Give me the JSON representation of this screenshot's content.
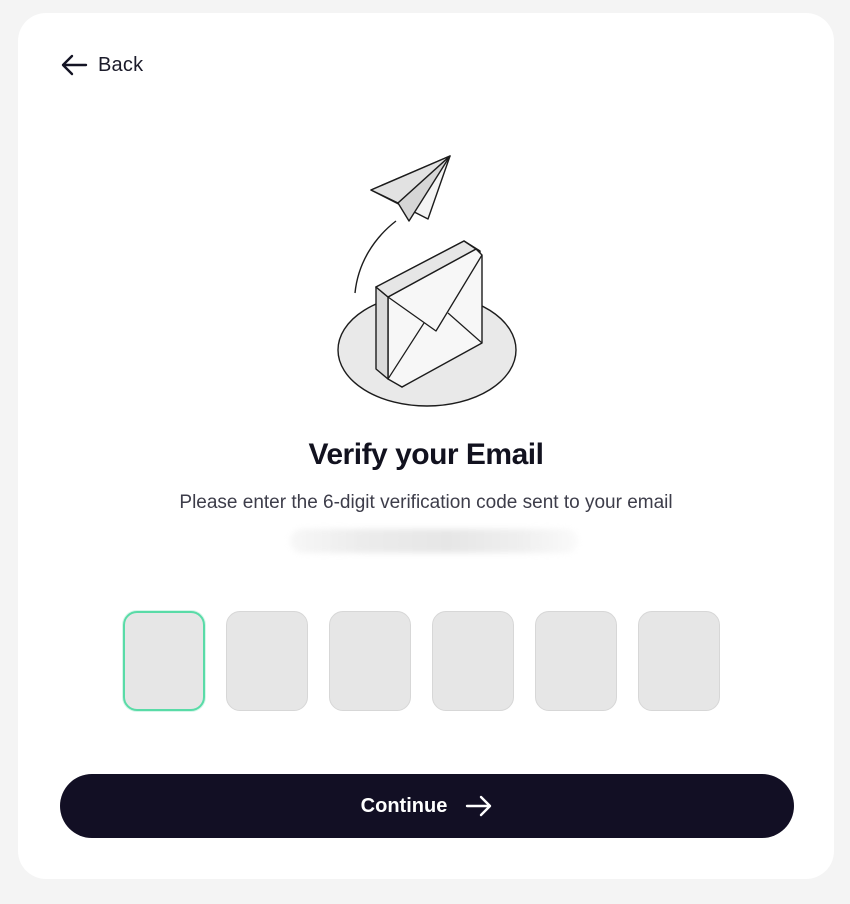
{
  "nav": {
    "back_label": "Back",
    "back_icon": "arrow-left-icon"
  },
  "illustration": {
    "icon": "envelope-with-paper-plane-illustration"
  },
  "heading": {
    "title": "Verify your Email",
    "subtitle": "Please enter the 6-digit verification code sent to your email"
  },
  "code_inputs": [
    {
      "value": "",
      "active": true
    },
    {
      "value": "",
      "active": false
    },
    {
      "value": "",
      "active": false
    },
    {
      "value": "",
      "active": false
    },
    {
      "value": "",
      "active": false
    },
    {
      "value": "",
      "active": false
    }
  ],
  "actions": {
    "continue_label": "Continue",
    "continue_icon": "arrow-right-icon"
  },
  "colors": {
    "primary_button": "#120f24",
    "focus_border": "#59dba7",
    "input_background": "#e6e6e6",
    "page_background": "#f4f4f4"
  }
}
